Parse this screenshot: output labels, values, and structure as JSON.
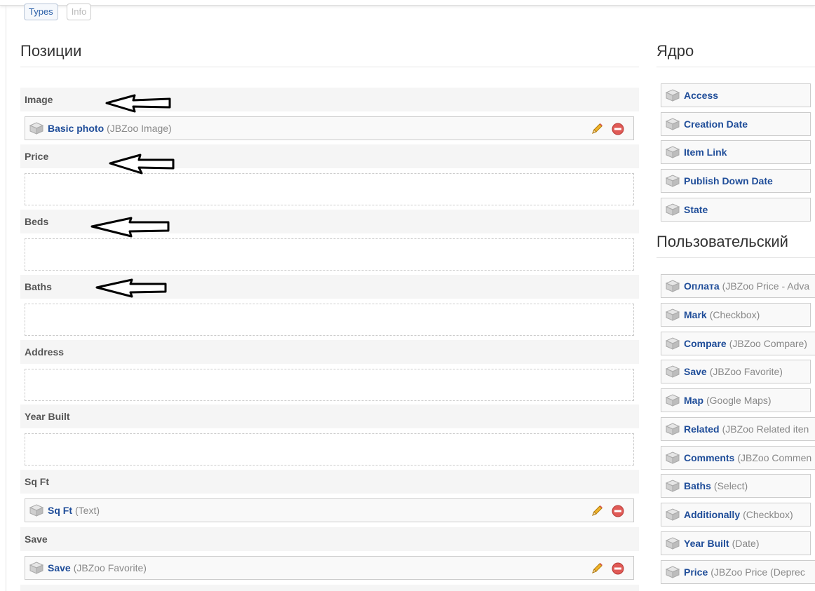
{
  "tabs": [
    {
      "label": "Types",
      "state": "active"
    },
    {
      "label": "Info",
      "state": "disabled"
    }
  ],
  "positions": {
    "title": "Позиции",
    "groups": [
      {
        "label": "Image",
        "elements": [
          {
            "name": "Basic photo",
            "type": "(JBZoo Image)"
          }
        ]
      },
      {
        "label": "Price",
        "elements": []
      },
      {
        "label": "Beds",
        "elements": []
      },
      {
        "label": "Baths",
        "elements": []
      },
      {
        "label": "Address",
        "elements": []
      },
      {
        "label": "Year Built",
        "elements": []
      },
      {
        "label": "Sq Ft",
        "elements": [
          {
            "name": "Sq Ft",
            "type": "(Text)"
          }
        ]
      },
      {
        "label": "Save",
        "elements": [
          {
            "name": "Save",
            "type": "(JBZoo Favorite)"
          }
        ]
      }
    ]
  },
  "core": {
    "title": "Ядро",
    "items": [
      {
        "name": "Access"
      },
      {
        "name": "Creation Date"
      },
      {
        "name": "Item Link"
      },
      {
        "name": "Publish Down Date"
      },
      {
        "name": "State"
      }
    ]
  },
  "custom": {
    "title": "Пользовательский",
    "items": [
      {
        "name": "Оплата",
        "type": "(JBZoo Price - Adva"
      },
      {
        "name": "Mark",
        "type": "(Checkbox)"
      },
      {
        "name": "Compare",
        "type": "(JBZoo Compare)"
      },
      {
        "name": "Save",
        "type": "(JBZoo Favorite)"
      },
      {
        "name": "Map",
        "type": "(Google Maps)"
      },
      {
        "name": "Related",
        "type": "(JBZoo Related iten"
      },
      {
        "name": "Comments",
        "type": "(JBZoo Commen"
      },
      {
        "name": "Baths",
        "type": "(Select)"
      },
      {
        "name": "Additionally",
        "type": "(Checkbox)"
      },
      {
        "name": "Year Built",
        "type": "(Date)"
      },
      {
        "name": "Price",
        "type": "(JBZoo Price (Deprec"
      }
    ]
  },
  "icons": {
    "element": "cube-icon",
    "edit": "pencil-icon",
    "remove": "remove-icon"
  },
  "colors": {
    "link": "#1f4d99",
    "type_text": "#888888",
    "remove": "#d9534f",
    "edit": "#e8a317"
  }
}
